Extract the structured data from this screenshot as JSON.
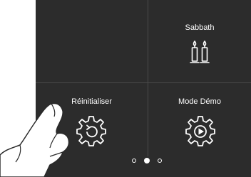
{
  "menu": {
    "tiles": [
      {
        "label": "Sabbath",
        "icon": "candles-icon"
      },
      {
        "label": "Réinitialiser",
        "icon": "gear-reset-icon"
      },
      {
        "label": "Mode Démo",
        "icon": "gear-play-icon"
      }
    ]
  },
  "pager": {
    "total": 3,
    "current": 2
  },
  "colors": {
    "panel": "#2c2c2c",
    "text": "#ffffff",
    "divider": "#4a4a4a"
  }
}
